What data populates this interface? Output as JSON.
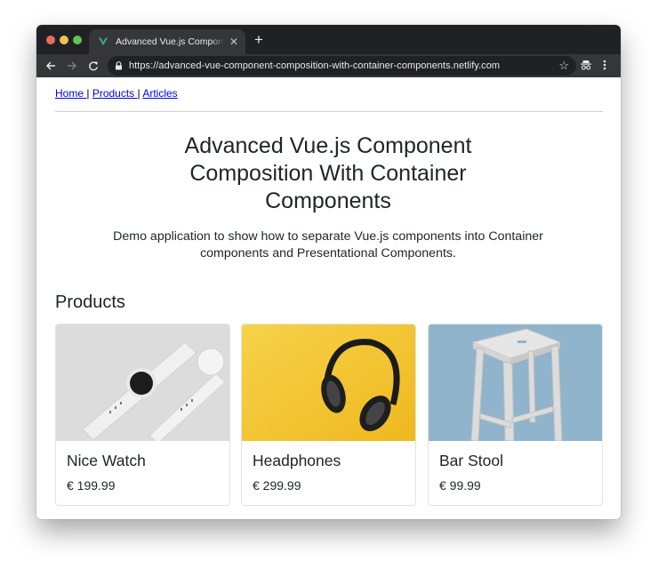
{
  "browser": {
    "tab_title": "Advanced Vue.js Component Composition With Container Components",
    "favicon": "vue-logo-icon",
    "url": "https://advanced-vue-component-composition-with-container-components.netlify.com",
    "colors": {
      "titlebar": "#202124",
      "toolbar": "#35363a",
      "vue_green": "#41b883"
    }
  },
  "nav": {
    "links": [
      {
        "label": "Home "
      },
      {
        "label": "Products "
      },
      {
        "label": "Articles"
      }
    ],
    "separator": "|"
  },
  "hero": {
    "title": "Advanced Vue.js Component Composition With Container Components",
    "subtitle": "Demo application to show how to separate Vue.js components into Container components and Presentational Components."
  },
  "products": {
    "heading": "Products",
    "items": [
      {
        "name": "Nice Watch",
        "price": "€ 199.99",
        "image": "watch-image"
      },
      {
        "name": "Headphones",
        "price": "€ 299.99",
        "image": "headphones-image"
      },
      {
        "name": "Bar Stool",
        "price": "€ 99.99",
        "image": "bar-stool-image"
      }
    ]
  }
}
